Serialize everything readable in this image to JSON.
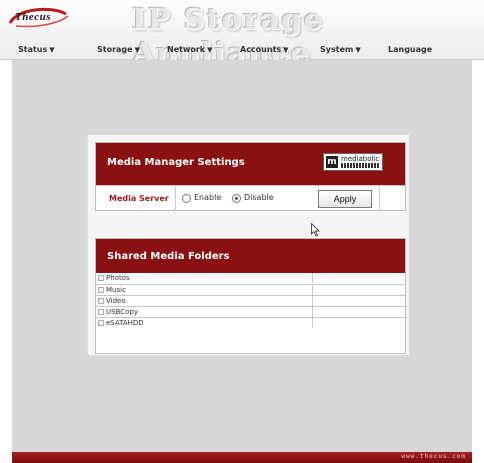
{
  "header": {
    "logo_text": "Thecus",
    "app_title": "IP Storage Appliance"
  },
  "nav": {
    "items": [
      {
        "label": "Status",
        "has_menu": true
      },
      {
        "label": "Storage",
        "has_menu": true
      },
      {
        "label": "Network",
        "has_menu": true
      },
      {
        "label": "Accounts",
        "has_menu": true
      },
      {
        "label": "System",
        "has_menu": true
      },
      {
        "label": "Language",
        "has_menu": false
      }
    ],
    "caret": "▼"
  },
  "media_manager": {
    "title": "Media Manager Settings",
    "brand": {
      "icon": "m",
      "name": "mediabolic"
    },
    "server_label": "Media Server",
    "enable_label": "Enable",
    "disable_label": "Disable",
    "selected": "Disable",
    "apply_label": "Apply"
  },
  "shared_folders": {
    "title": "Shared Media Folders",
    "folders": [
      "Photos",
      "Music",
      "Video",
      "USBCopy",
      "eSATAHDD"
    ]
  },
  "footer": {
    "url": "www.thecus.com"
  },
  "colors": {
    "accent": "#8a1111",
    "content_bg": "#d7d7d7",
    "label": "#9c1a1a"
  }
}
